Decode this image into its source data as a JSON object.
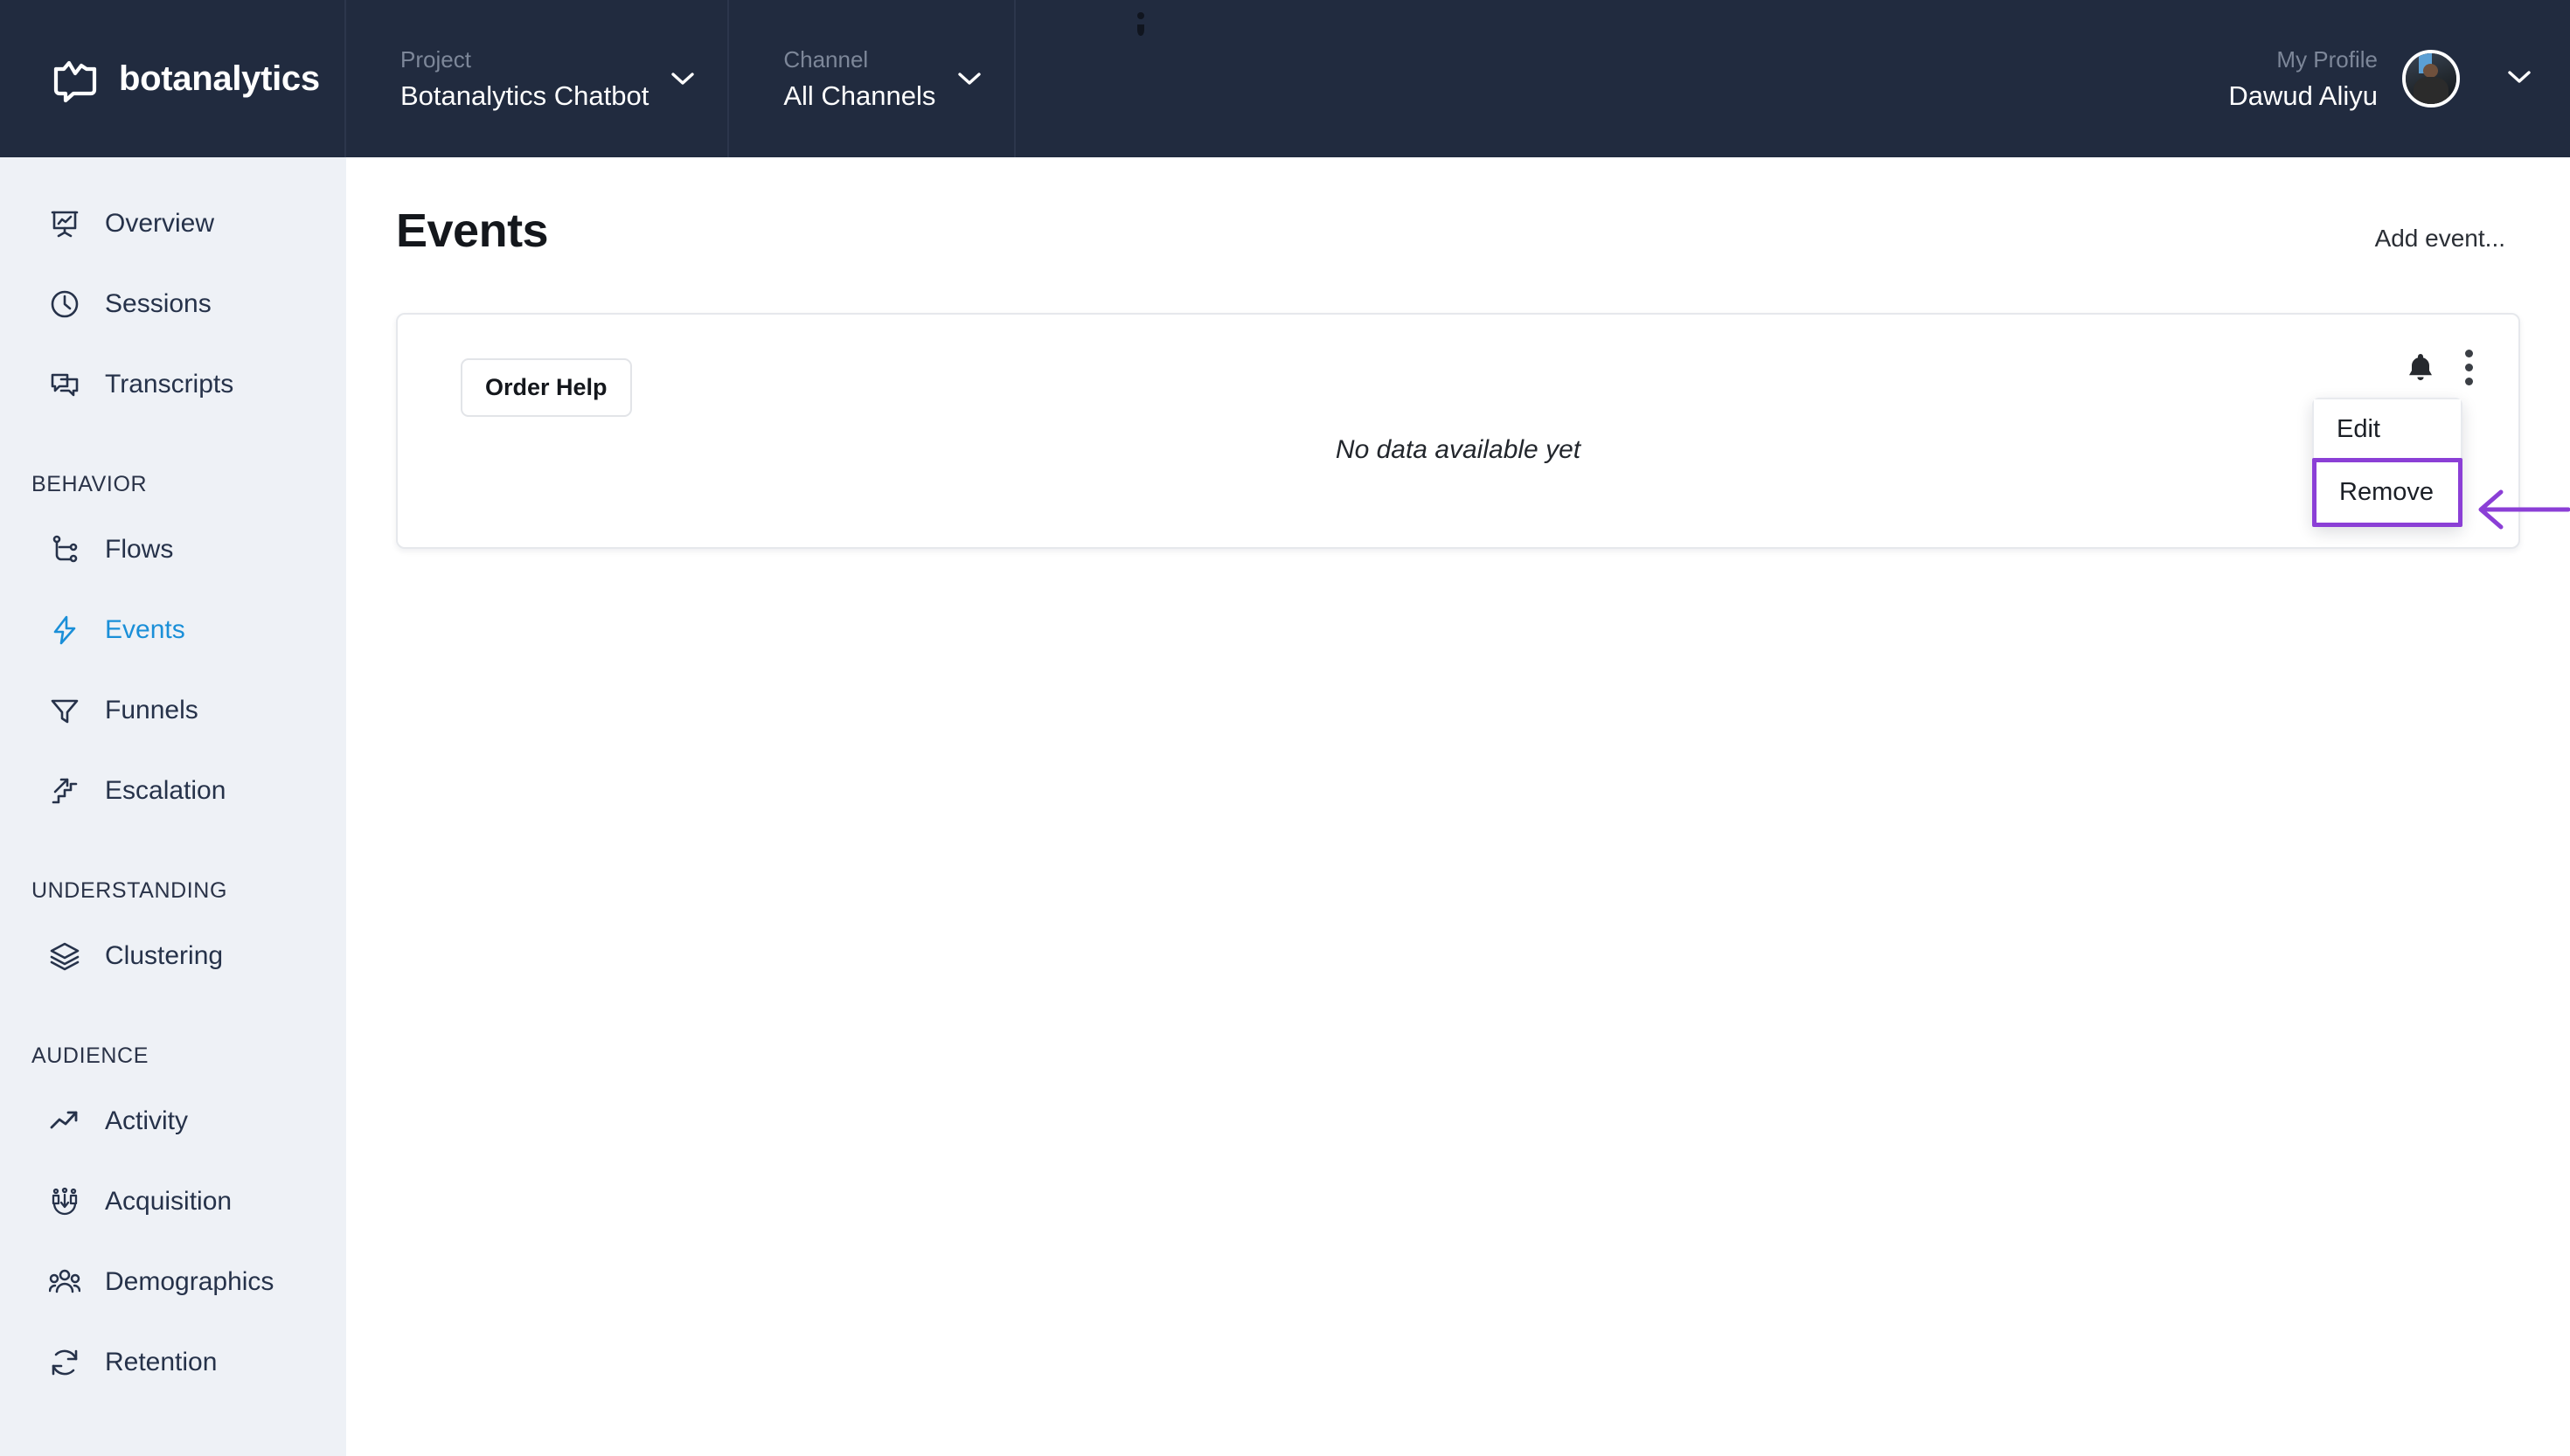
{
  "brand": {
    "name": "botanalytics",
    "logo_icon": "speech-bubble-chart-logo"
  },
  "topbar": {
    "project": {
      "label": "Project",
      "value": "Botanalytics Chatbot",
      "caret_icon": "chevron-down-icon"
    },
    "channel": {
      "label": "Channel",
      "value": "All Channels",
      "caret_icon": "chevron-down-icon"
    },
    "profile": {
      "label": "My Profile",
      "value": "Dawud Aliyu",
      "avatar_icon": "user-avatar",
      "caret_icon": "chevron-down-icon"
    },
    "drag_handle_icon": "drag-handle-dots"
  },
  "sidebar": {
    "top_items": [
      {
        "label": "Overview",
        "icon": "presentation-chart-icon",
        "active": false
      },
      {
        "label": "Sessions",
        "icon": "clock-icon",
        "active": false
      },
      {
        "label": "Transcripts",
        "icon": "chat-bubbles-icon",
        "active": false
      }
    ],
    "sections": [
      {
        "title": "BEHAVIOR",
        "items": [
          {
            "label": "Flows",
            "icon": "flow-nodes-icon",
            "active": false
          },
          {
            "label": "Events",
            "icon": "lightning-bolt-icon",
            "active": true
          },
          {
            "label": "Funnels",
            "icon": "funnel-icon",
            "active": false
          },
          {
            "label": "Escalation",
            "icon": "stairs-arrow-up-icon",
            "active": false
          }
        ]
      },
      {
        "title": "UNDERSTANDING",
        "items": [
          {
            "label": "Clustering",
            "icon": "layers-icon",
            "active": false
          }
        ]
      },
      {
        "title": "AUDIENCE",
        "items": [
          {
            "label": "Activity",
            "icon": "trend-arrow-up-icon",
            "active": false
          },
          {
            "label": "Acquisition",
            "icon": "magnet-people-icon",
            "active": false
          },
          {
            "label": "Demographics",
            "icon": "people-group-icon",
            "active": false
          },
          {
            "label": "Retention",
            "icon": "refresh-cycle-icon",
            "active": false
          }
        ]
      }
    ]
  },
  "main": {
    "title": "Events",
    "add_event_label": "Add event...",
    "card": {
      "chip_label": "Order Help",
      "empty_message": "No data available yet",
      "bell_icon": "notification-bell-icon",
      "kebab_icon": "more-vertical-icon"
    },
    "menu": {
      "items": [
        {
          "label": "Edit",
          "highlighted": false
        },
        {
          "label": "Remove",
          "highlighted": true
        }
      ]
    },
    "annotation": {
      "arrow_icon": "left-arrow-annotation",
      "color": "#8b3fd6"
    }
  },
  "colors": {
    "topbar_bg": "#212b3f",
    "sidebar_bg": "#eef1f6",
    "content_bg": "#ffffff",
    "accent_active": "#1a8fd8",
    "annotation_purple": "#8b3fd6",
    "text_dark": "#26324a",
    "muted_label": "#7d8799"
  }
}
